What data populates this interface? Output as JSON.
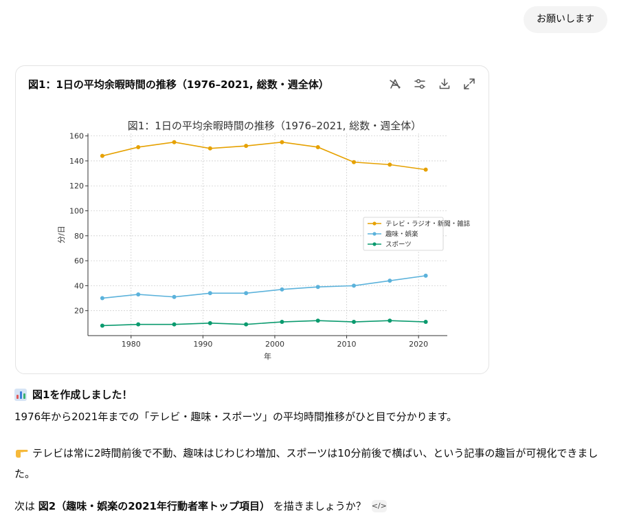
{
  "user_message": "お願いします",
  "card": {
    "title": "図1：1日の平均余暇時間の推移（1976–2021, 総数・週全体）",
    "tools": [
      "edit-chart-icon",
      "settings-sliders-icon",
      "download-icon",
      "expand-icon"
    ]
  },
  "chart_data": {
    "type": "line",
    "title": "図1：1日の平均余暇時間の推移（1976–2021, 総数・週全体）",
    "xlabel": "年",
    "ylabel": "分/日",
    "x": [
      1976,
      1981,
      1986,
      1991,
      1996,
      2001,
      2006,
      2011,
      2016,
      2021
    ],
    "xticks": [
      1980,
      1990,
      2000,
      2010,
      2020
    ],
    "yticks": [
      20,
      40,
      60,
      80,
      100,
      120,
      140,
      160
    ],
    "xlim": [
      1974,
      2024
    ],
    "ylim": [
      0,
      162
    ],
    "grid": true,
    "legend_position": "right",
    "series": [
      {
        "name": "テレビ・ラジオ・新聞・雑誌",
        "color": "#E6A100",
        "values": [
          144,
          151,
          155,
          150,
          152,
          155,
          151,
          139,
          137,
          133
        ]
      },
      {
        "name": "趣味・娯楽",
        "color": "#5BB2DB",
        "values": [
          30,
          33,
          31,
          34,
          34,
          37,
          39,
          40,
          44,
          48
        ]
      },
      {
        "name": "スポーツ",
        "color": "#0A9A6E",
        "values": [
          8,
          9,
          9,
          10,
          9,
          11,
          12,
          11,
          12,
          11
        ]
      }
    ]
  },
  "reply": {
    "heading": "図1を作成しました！",
    "line1": "1976年から2021年までの「テレビ・趣味・スポーツ」の平均時間推移がひと目で分かります。",
    "line2": "テレビは常に2時間前後で不動、趣味はじわじわ増加、スポーツは10分前後で横ばい、という記事の趣旨が可視化できました。",
    "line3_prefix": "次は ",
    "line3_bold": "図2（趣味・娯楽の2021年行動者率トップ項目）",
    "line3_suffix": " を描きましょうか？",
    "code_chip": "</>"
  }
}
